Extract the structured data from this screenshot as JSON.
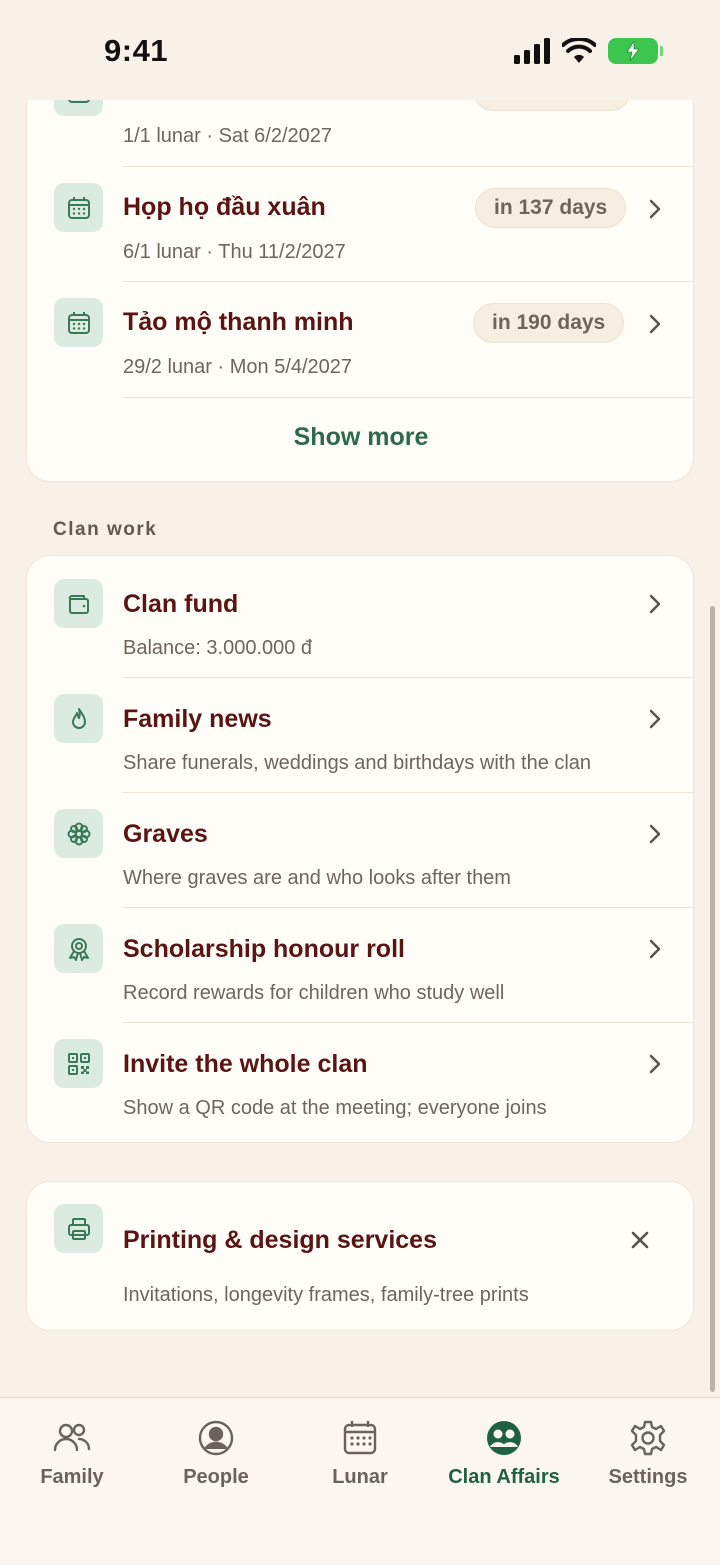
{
  "status_bar": {
    "time": "9:41"
  },
  "events_card": {
    "partial_row": {
      "subtitle": "1/1 lunar · Sat 6/2/2027"
    },
    "items": [
      {
        "title": "Họp họ đầu xuân",
        "subtitle": "6/1 lunar · Thu 11/2/2027",
        "badge": "in 137 days",
        "icon": "calendar-icon"
      },
      {
        "title": "Tảo mộ thanh minh",
        "subtitle": "29/2 lunar · Mon 5/4/2027",
        "badge": "in 190 days",
        "icon": "calendar-icon"
      }
    ],
    "show_more": "Show more"
  },
  "clan_work": {
    "header": "Clan work",
    "items": [
      {
        "title": "Clan fund",
        "subtitle": "Balance: 3.000.000 đ",
        "icon": "wallet-icon"
      },
      {
        "title": "Family news",
        "subtitle": "Share funerals, weddings and birthdays with the clan",
        "icon": "flame-icon"
      },
      {
        "title": "Graves",
        "subtitle": "Where graves are and who looks after them",
        "icon": "flower-icon"
      },
      {
        "title": "Scholarship honour roll",
        "subtitle": "Record rewards for children who study well",
        "icon": "award-ribbon-icon"
      },
      {
        "title": "Invite the whole clan",
        "subtitle": "Show a QR code at the meeting; everyone joins",
        "icon": "qr-code-icon"
      }
    ]
  },
  "promo": {
    "title": "Printing & design services",
    "subtitle": "Invitations, longevity frames, family-tree prints",
    "icon": "printer-icon"
  },
  "tabbar": {
    "active": "Clan Affairs",
    "tabs": [
      {
        "label": "Family",
        "icon": "users-icon"
      },
      {
        "label": "People",
        "icon": "person-circle-icon"
      },
      {
        "label": "Lunar",
        "icon": "calendar-icon"
      },
      {
        "label": "Clan Affairs",
        "icon": "clan-group-icon"
      },
      {
        "label": "Settings",
        "icon": "gear-icon"
      }
    ]
  },
  "colors": {
    "background": "#f8f1e7",
    "card": "#fffdf8",
    "title": "#5a1414",
    "accent_green": "#2e6a4a",
    "icon_bg": "#dcebe2",
    "battery": "#3cc64f"
  }
}
